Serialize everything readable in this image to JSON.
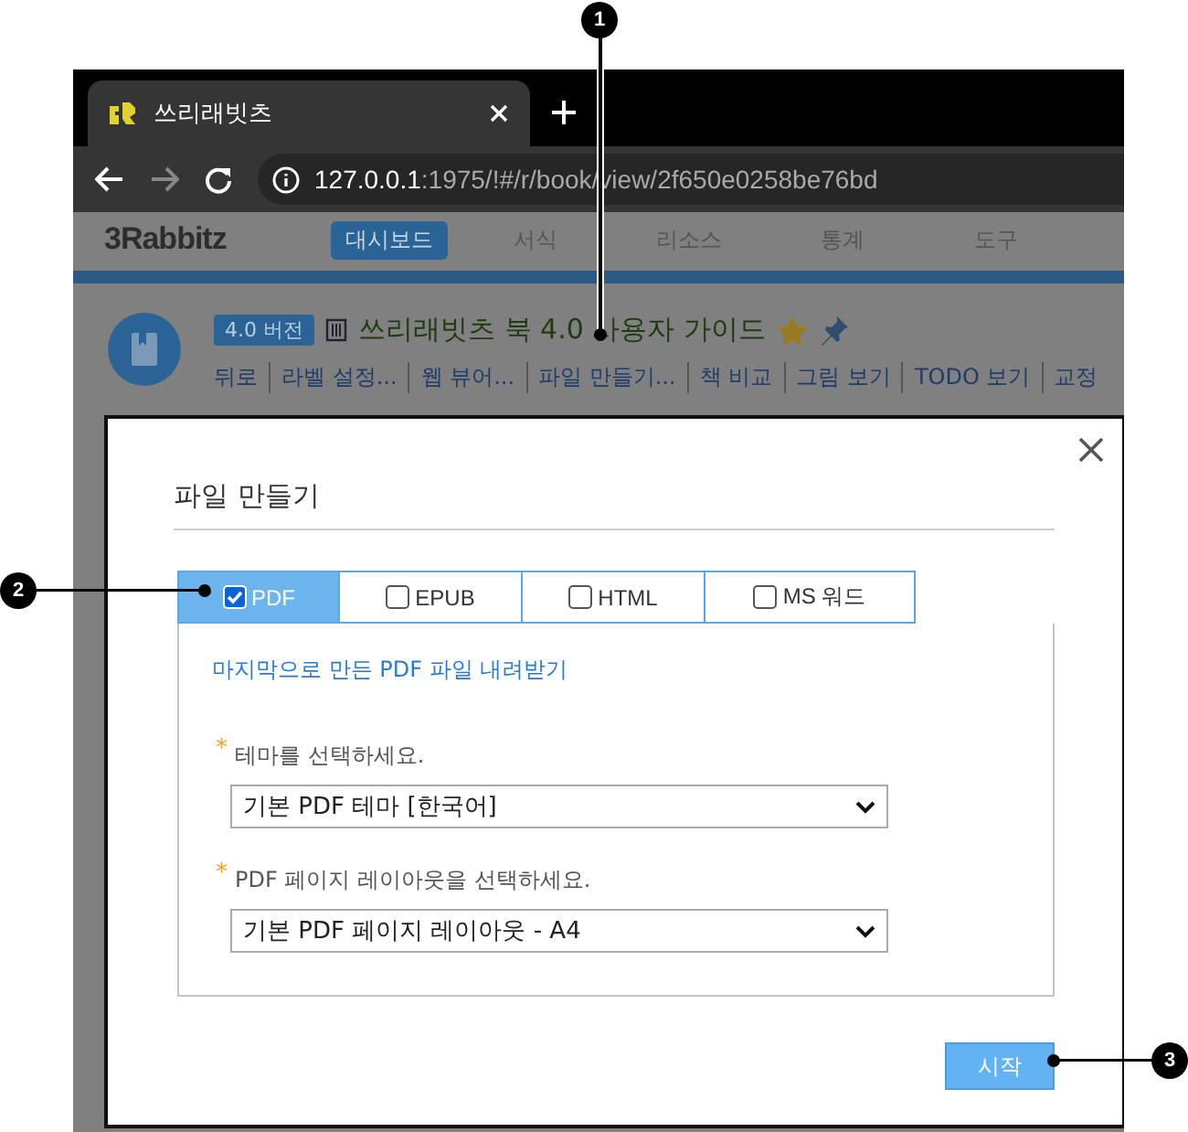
{
  "browser": {
    "tab_title": "쓰리래빗츠",
    "url_host": "127.0.0.1",
    "url_path": ":1975/!#/r/book/view/2f650e0258be76bd"
  },
  "app": {
    "logo": "3Rabbitz",
    "nav": [
      {
        "label": "대시보드",
        "selected": true
      },
      {
        "label": "서식",
        "selected": false
      },
      {
        "label": "리소스",
        "selected": false
      },
      {
        "label": "통계",
        "selected": false
      },
      {
        "label": "도구",
        "selected": false
      }
    ]
  },
  "book": {
    "version": "4.0 버전",
    "title": "쓰리래빗츠 북 4.0 사용자 가이드",
    "actions": [
      "뒤로",
      "라벨 설정...",
      "웹 뷰어...",
      "파일 만들기...",
      "책 비교",
      "그림 보기",
      "TODO 보기",
      "교정"
    ]
  },
  "dialog": {
    "title": "파일 만들기",
    "tabs": [
      {
        "label": "PDF",
        "selected": true,
        "checked": true
      },
      {
        "label": "EPUB",
        "selected": false,
        "checked": false
      },
      {
        "label": "HTML",
        "selected": false,
        "checked": false
      },
      {
        "label": "MS 워드",
        "selected": false,
        "checked": false
      }
    ],
    "download_link": "마지막으로 만든 PDF 파일 내려받기",
    "fields": [
      {
        "label": "테마를 선택하세요.",
        "required_mark": "*",
        "value": "기본 PDF 테마 [한국어]"
      },
      {
        "label": "PDF 페이지 레이아웃을 선택하세요.",
        "required_mark": "*",
        "value": "기본 PDF 페이지 레이아웃 - A4"
      }
    ],
    "start_button": "시작"
  },
  "callouts": [
    "1",
    "2",
    "3"
  ]
}
